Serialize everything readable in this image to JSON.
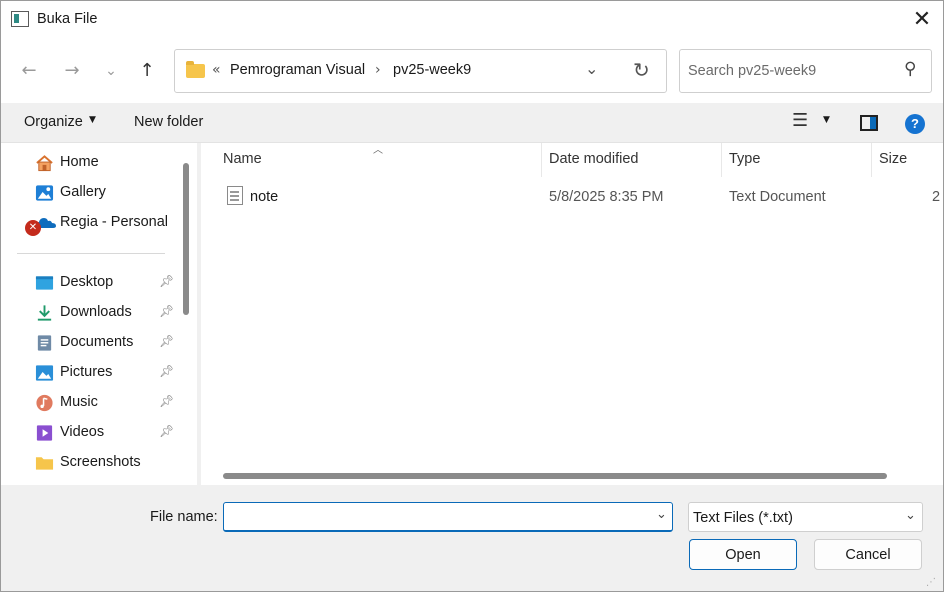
{
  "window": {
    "title": "Buka File",
    "close_glyph": "✕"
  },
  "nav": {
    "back_glyph": "←",
    "forward_glyph": "→",
    "recent_glyph": "⌄",
    "up_glyph": "↑",
    "breadcrumb_overflow": "«",
    "breadcrumb": [
      "Pemrograman Visual",
      "pv25-week9"
    ],
    "breadcrumb_sep": "›",
    "dropdown_glyph": "⌄",
    "refresh_glyph": "↻"
  },
  "search": {
    "placeholder": "Search pv25-week9"
  },
  "toolbar": {
    "organize_label": "Organize",
    "new_folder_label": "New folder",
    "help_glyph": "?"
  },
  "sidebar": {
    "quick": [
      {
        "label": "Home",
        "icon": "home-icon"
      },
      {
        "label": "Gallery",
        "icon": "gallery-icon"
      },
      {
        "label": "Regia - Personal",
        "icon": "onedrive-icon"
      }
    ],
    "pinned": [
      {
        "label": "Desktop",
        "icon": "desktop-icon",
        "pinned": true
      },
      {
        "label": "Downloads",
        "icon": "download-icon",
        "pinned": true
      },
      {
        "label": "Documents",
        "icon": "documents-icon",
        "pinned": true
      },
      {
        "label": "Pictures",
        "icon": "pictures-icon",
        "pinned": true
      },
      {
        "label": "Music",
        "icon": "music-icon",
        "pinned": true
      },
      {
        "label": "Videos",
        "icon": "videos-icon",
        "pinned": true
      },
      {
        "label": "Screenshots",
        "icon": "folder-icon",
        "pinned": false
      }
    ]
  },
  "files": {
    "columns": [
      "Name",
      "Date modified",
      "Type",
      "Size"
    ],
    "rows": [
      {
        "name": "note",
        "date": "5/8/2025 8:35 PM",
        "type": "Text Document",
        "size": "2"
      }
    ]
  },
  "footer": {
    "file_name_label": "File name:",
    "file_name_value": "",
    "filter_value": "Text Files (*.txt)",
    "open_label": "Open",
    "cancel_label": "Cancel"
  },
  "colors": {
    "accent": "#0a6ab8",
    "folder": "#f6c54b",
    "error": "#c42b1c"
  }
}
